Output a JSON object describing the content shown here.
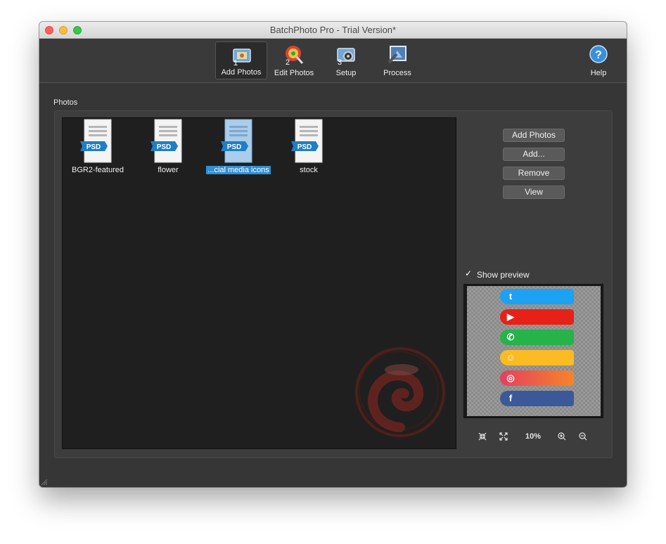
{
  "window": {
    "title": "BatchPhoto Pro - Trial Version*"
  },
  "toolbar": {
    "items": [
      {
        "label": "Add Photos",
        "icon": "add-photos-icon",
        "step": "1"
      },
      {
        "label": "Edit Photos",
        "icon": "edit-photos-icon",
        "step": "2"
      },
      {
        "label": "Setup",
        "icon": "setup-icon",
        "step": "3"
      },
      {
        "label": "Process",
        "icon": "process-icon",
        "step": ""
      }
    ],
    "help_label": "Help"
  },
  "photos": {
    "section_label": "Photos",
    "file_badge": "PSD",
    "items": [
      {
        "name": "BGR2-featured",
        "selected": false
      },
      {
        "name": "flower",
        "selected": false
      },
      {
        "name": "...cial media icons",
        "selected": true
      },
      {
        "name": "stock",
        "selected": false
      }
    ]
  },
  "side_buttons": {
    "add_photos": "Add Photos",
    "add": "Add...",
    "remove": "Remove",
    "view": "View"
  },
  "preview": {
    "show_preview_label": "Show preview",
    "show_preview_checked": true,
    "zoom": "10%",
    "stripes": [
      {
        "icon": "twitter-icon",
        "glyph": "t",
        "color": "#1da1f2"
      },
      {
        "icon": "youtube-icon",
        "glyph": "▶",
        "color": "#e62117"
      },
      {
        "icon": "whatsapp-icon",
        "glyph": "✆",
        "color": "#25b34a"
      },
      {
        "icon": "snapchat-icon",
        "glyph": "☺",
        "color": "#fbbb22"
      },
      {
        "icon": "instagram-icon",
        "glyph": "◎",
        "color": "#e4405f"
      },
      {
        "icon": "facebook-icon",
        "glyph": "f",
        "color": "#3b5998"
      }
    ]
  },
  "colors": {
    "window_bg": "#363636",
    "selection": "#2f8fd6",
    "psd_badge": "#1f7ec4"
  }
}
